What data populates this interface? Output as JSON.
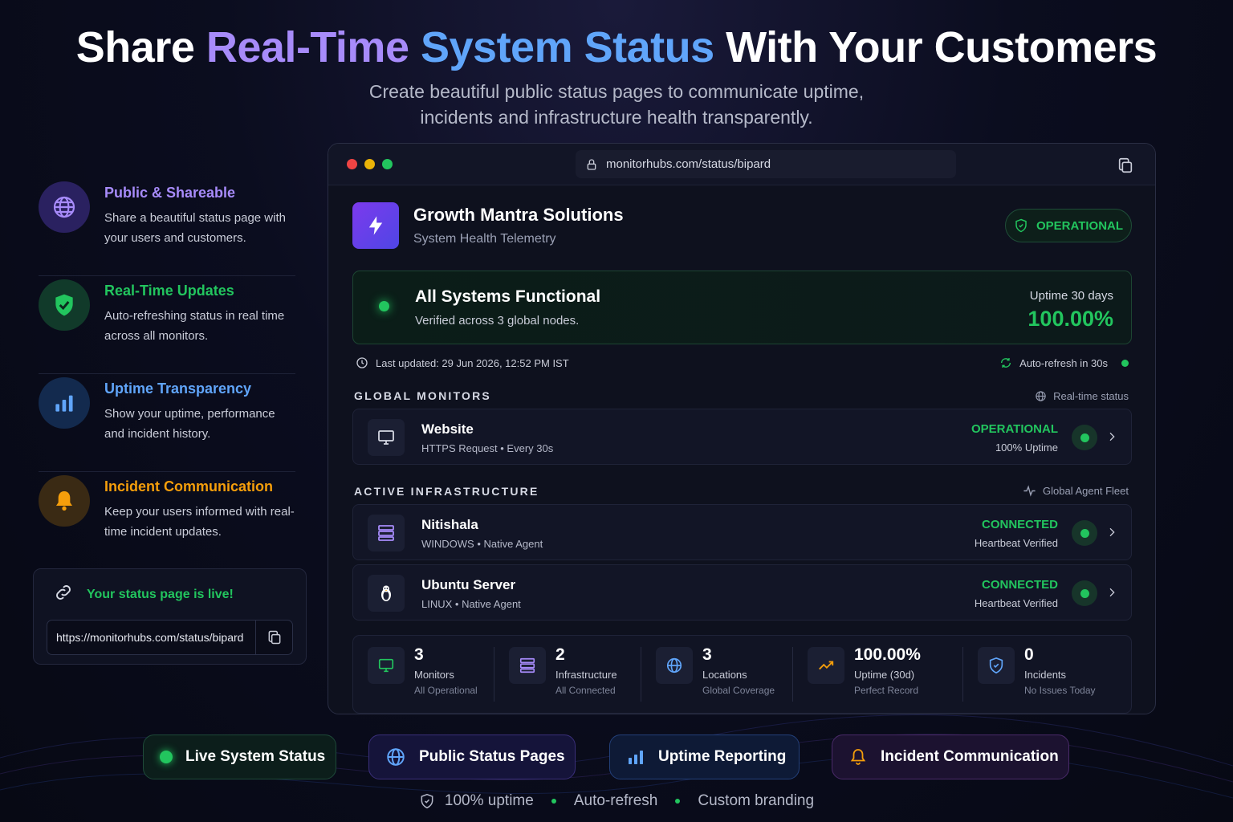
{
  "hero": {
    "title_part1": "Share ",
    "title_part2": "Real-Time ",
    "title_part3": "System Status",
    "title_part4": " With Your Customers",
    "subtitle": "Create beautiful public status pages to communicate uptime, incidents and infrastructure health transparently."
  },
  "features": [
    {
      "icon": "globe-icon",
      "color": "#a78bfa",
      "title": "Public & Shareable",
      "desc": "Share a beautiful status page with your users and customers."
    },
    {
      "icon": "shield-check-icon",
      "color": "#22c55e",
      "title": "Real-Time Updates",
      "desc": "Auto-refreshing status in real time across all monitors."
    },
    {
      "icon": "bar-chart-icon",
      "color": "#60a5fa",
      "title": "Uptime Transparency",
      "desc": "Show your uptime, performance and incident history."
    },
    {
      "icon": "bell-icon",
      "color": "#f59e0b",
      "title": "Incident Communication",
      "desc": "Keep your users informed with real-time incident updates."
    }
  ],
  "live_card": {
    "title": "Your status page is live!",
    "url": "https://monitorhubs.com/status/bipard"
  },
  "browser": {
    "address": "monitorhubs.com/status/bipard"
  },
  "org": {
    "name": "Growth Mantra Solutions",
    "subtitle": "System Health Telemetry",
    "status": "OPERATIONAL"
  },
  "banner": {
    "title": "All Systems Functional",
    "subtitle": "Verified across 3 global nodes.",
    "uptime_label": "Uptime 30 days",
    "uptime_value": "100.00%"
  },
  "meta": {
    "last_updated": "Last updated: 29 Jun 2026, 12:52 PM IST",
    "auto_refresh": "Auto-refresh in 30s"
  },
  "monitors_section": {
    "title": "GLOBAL MONITORS",
    "right": "Real-time status",
    "items": [
      {
        "title": "Website",
        "sub": "HTTPS Request • Every 30s",
        "status": "OPERATIONAL",
        "note": "100% Uptime"
      }
    ]
  },
  "infra_section": {
    "title": "ACTIVE INFRASTRUCTURE",
    "right": "Global Agent Fleet",
    "items": [
      {
        "title": "Nitishala",
        "sub": "WINDOWS • Native Agent",
        "status": "CONNECTED",
        "note": "Heartbeat Verified"
      },
      {
        "title": "Ubuntu Server",
        "sub": "LINUX • Native Agent",
        "status": "CONNECTED",
        "note": "Heartbeat Verified"
      }
    ]
  },
  "stats": [
    {
      "value": "3",
      "label": "Monitors",
      "sub": "All Operational",
      "color": "#22c55e"
    },
    {
      "value": "2",
      "label": "Infrastructure",
      "sub": "All Connected",
      "color": "#a78bfa"
    },
    {
      "value": "3",
      "label": "Locations",
      "sub": "Global Coverage",
      "color": "#60a5fa"
    },
    {
      "value": "100.00%",
      "label": "Uptime (30d)",
      "sub": "Perfect Record",
      "color": "#f59e0b"
    },
    {
      "value": "0",
      "label": "Incidents",
      "sub": "No Issues Today",
      "color": "#60a5fa"
    }
  ],
  "pills": [
    "Live System Status",
    "Public Status Pages",
    "Uptime Reporting",
    "Incident Communication"
  ],
  "footer": [
    "100% uptime",
    "Auto-refresh",
    "Custom branding"
  ]
}
